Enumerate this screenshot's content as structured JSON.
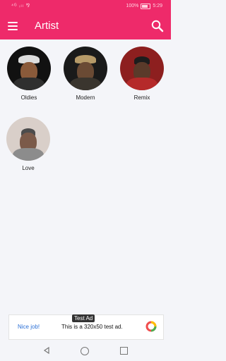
{
  "status": {
    "left": "⁴ᴳ ᵢₗₗ ⅋",
    "battery": "100%",
    "time": "5:29"
  },
  "appbar": {
    "title": "Artist"
  },
  "artists": [
    {
      "name": "Oldies"
    },
    {
      "name": "Modern"
    },
    {
      "name": "Remix"
    },
    {
      "name": "Love"
    }
  ],
  "ad": {
    "tag": "Test Ad",
    "left": "Nice job!",
    "text": "This is a 320x50 test ad."
  }
}
